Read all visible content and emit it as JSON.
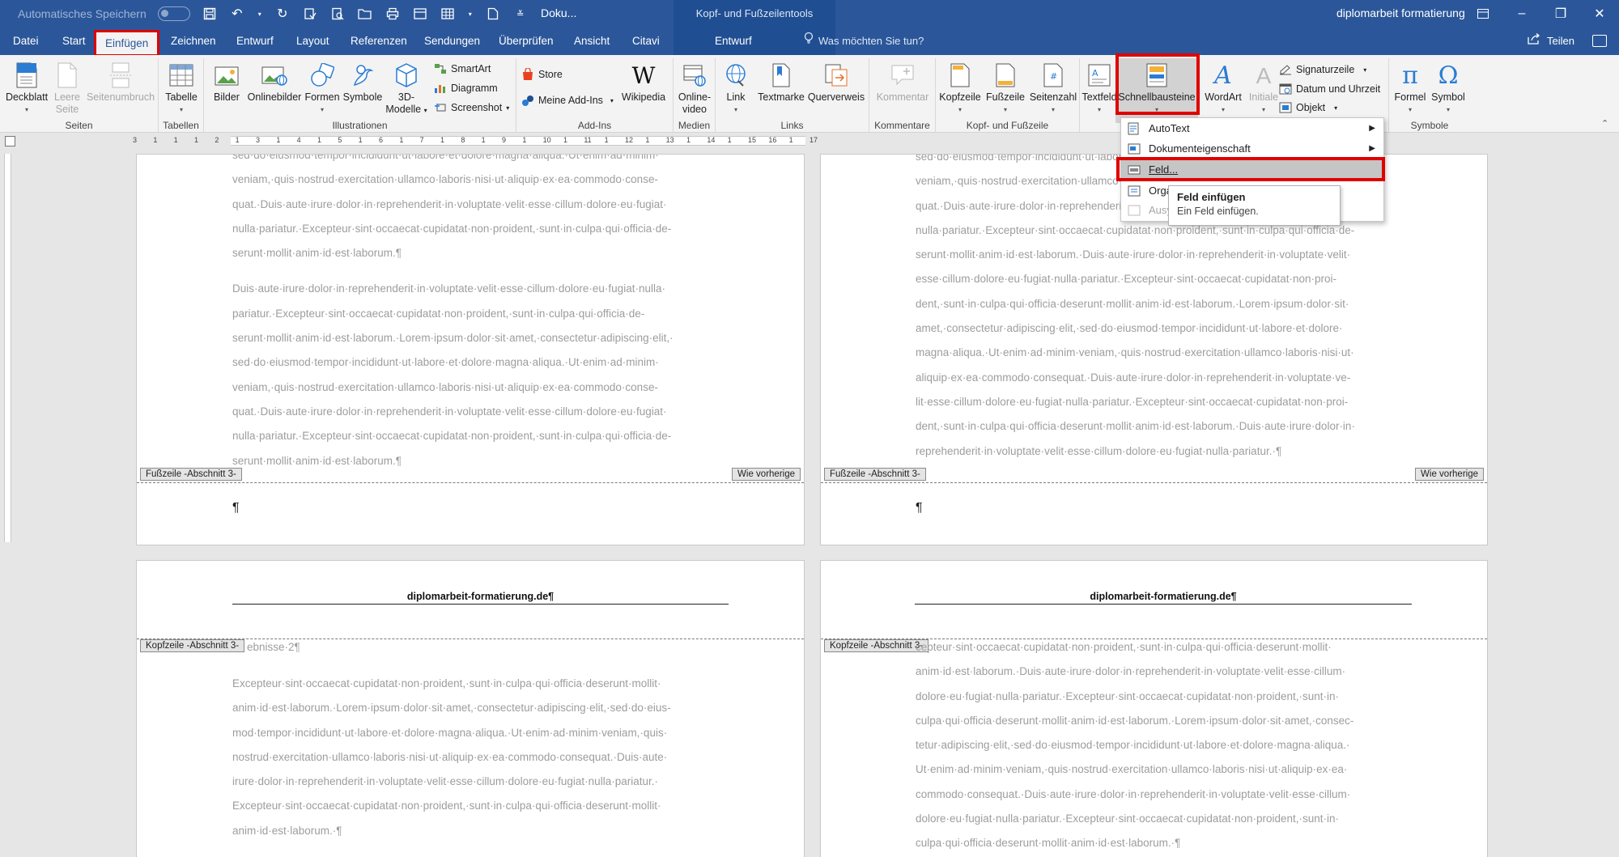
{
  "titlebar": {
    "autosave_label": "Automatisches Speichern",
    "doc_title": "Doku...",
    "context_title": "Kopf- und Fußzeilentools",
    "user": "diplomarbeit formatierung"
  },
  "tabs": [
    {
      "label": "Datei"
    },
    {
      "label": "Start"
    },
    {
      "label": "Einfügen"
    },
    {
      "label": "Zeichnen"
    },
    {
      "label": "Entwurf"
    },
    {
      "label": "Layout"
    },
    {
      "label": "Referenzen"
    },
    {
      "label": "Sendungen"
    },
    {
      "label": "Überprüfen"
    },
    {
      "label": "Ansicht"
    },
    {
      "label": "Citavi"
    },
    {
      "label": "Entwurf"
    }
  ],
  "search_placeholder": "Was möchten Sie tun?",
  "share_label": "Teilen",
  "ribbon": {
    "groups": {
      "seiten": "Seiten",
      "tabellen": "Tabellen",
      "illustrationen": "Illustrationen",
      "addins": "Add-Ins",
      "medien": "Medien",
      "links": "Links",
      "kommentare": "Kommentare",
      "kopffuss": "Kopf- und Fußzeile",
      "symbole": "Symbole"
    },
    "buttons": {
      "deckblatt": "Deckblatt",
      "leere_seite_1": "Leere",
      "leere_seite_2": "Seite",
      "seitenumbruch": "Seitenumbruch",
      "tabelle": "Tabelle",
      "bilder": "Bilder",
      "onlinebilder": "Onlinebilder",
      "formen": "Formen",
      "symbole_btn": "Symbole",
      "modelle_1": "3D-",
      "modelle_2": "Modelle",
      "smartart": "SmartArt",
      "diagramm": "Diagramm",
      "screenshot": "Screenshot",
      "store": "Store",
      "meine_addins": "Meine Add-Ins",
      "wikipedia": "Wikipedia",
      "onlinevideo_1": "Online-",
      "onlinevideo_2": "video",
      "link": "Link",
      "textmarke": "Textmarke",
      "querverweis": "Querverweis",
      "kommentar": "Kommentar",
      "kopfzeile": "Kopfzeile",
      "fusszeile": "Fußzeile",
      "seitenzahl": "Seitenzahl",
      "textfeld": "Textfeld",
      "schnellbausteine": "Schnellbausteine",
      "wordart": "WordArt",
      "initiale": "Initiale",
      "signaturzeile": "Signaturzeile",
      "datum": "Datum und Uhrzeit",
      "objekt": "Objekt",
      "formel": "Formel",
      "symbol": "Symbol"
    }
  },
  "ruler_ticks": [
    "3",
    "1",
    "1",
    "1",
    "2",
    "1",
    "3",
    "1",
    "4",
    "1",
    "5",
    "1",
    "6",
    "1",
    "7",
    "1",
    "8",
    "1",
    "9",
    "1",
    "10",
    "1",
    "11",
    "1",
    "12",
    "1",
    "13",
    "1",
    "14",
    "1",
    "15",
    "16",
    "1",
    "17"
  ],
  "dropdown": {
    "items": [
      "AutoText",
      "Dokumenteigenschaft",
      "Feld...",
      "Orga",
      "Ausy"
    ],
    "tooltip_title": "Feld einfügen",
    "tooltip_desc": "Ein Feld einfügen."
  },
  "pages": {
    "p1_paragraphs": [
      "sed·do·eiusmod·tempor·incididunt·ut·labore·et·dolore·magna·aliqua.·Ut·enim·ad·minim· veniam,·quis·nostrud·exercitation·ullamco·laboris·nisi·ut·aliquip·ex·ea·commodo·conse- quat.·Duis·aute·irure·dolor·in·reprehenderit·in·voluptate·velit·esse·cillum·dolore·eu·fugiat· nulla·pariatur.·Excepteur·sint·occaecat·cupidatat·non·proident,·sunt·in·culpa·qui·officia·de- serunt·mollit·anim·id·est·laborum.¶",
      "Duis·aute·irure·dolor·in·reprehenderit·in·voluptate·velit·esse·cillum·dolore·eu·fugiat·nulla· pariatur.·Excepteur·sint·occaecat·cupidatat·non·proident,·sunt·in·culpa·qui·officia·de- serunt·mollit·anim·id·est·laborum.·Lorem·ipsum·dolor·sit·amet,·consectetur·adipiscing·elit,· sed·do·eiusmod·tempor·incididunt·ut·labore·et·dolore·magna·aliqua.·Ut·enim·ad·minim· veniam,·quis·nostrud·exercitation·ullamco·laboris·nisi·ut·aliquip·ex·ea·commodo·conse- quat.·Duis·aute·irure·dolor·in·reprehenderit·in·voluptate·velit·esse·cillum·dolore·eu·fugiat· nulla·pariatur.·Excepteur·sint·occaecat·cupidatat·non·proident,·sunt·in·culpa·qui·officia·de- serunt·mollit·anim·id·est·laborum.¶"
    ],
    "p2_paragraph": "sed·do·eiusmod·tempor·incididunt·ut·labore·et·dolore·magna·aliqua.·Ut·enim·ad·minim· veniam,·quis·nostrud·exercitation·ullamco·laboris·nisi·ut·aliquip·ex·ea·commodo·conse- quat.·Duis·aute·irure·dolor·in·reprehenderit·in·voluptate·velit·esse·cillum·dolore·eu·fugiat· nulla·pariatur.·Excepteur·sint·occaecat·cupidatat·non·proident,·sunt·in·culpa·qui·officia·de- serunt·mollit·anim·id·est·laborum.·Duis·aute·irure·dolor·in·reprehenderit·in·voluptate·velit· esse·cillum·dolore·eu·fugiat·nulla·pariatur.·Excepteur·sint·occaecat·cupidatat·non·proi- dent,·sunt·in·culpa·qui·officia·deserunt·mollit·anim·id·est·laborum.·Lorem·ipsum·dolor·sit· amet,·consectetur·adipiscing·elit,·sed·do·eiusmod·tempor·incididunt·ut·labore·et·dolore· magna·aliqua.·Ut·enim·ad·minim·veniam,·quis·nostrud·exercitation·ullamco·laboris·nisi·ut· aliquip·ex·ea·commodo·consequat.·Duis·aute·irure·dolor·in·reprehenderit·in·voluptate·ve- lit·esse·cillum·dolore·eu·fugiat·nulla·pariatur.·Excepteur·sint·occaecat·cupidatat·non·proi- dent,·sunt·in·culpa·qui·officia·deserunt·mollit·anim·id·est·laborum.·Duis·aute·irure·dolor·in· reprehenderit·in·voluptate·velit·esse·cillum·dolore·eu·fugiat·nulla·pariatur.·¶",
    "footer_label": "Fußzeile -Abschnitt 3-",
    "same_as_prev": "Wie vorherige",
    "header_label": "Kopfzeile -Abschnitt 3-",
    "header_text": "diplomarbeit-formatierung.de¶",
    "pilcrow": "¶",
    "p3_heading_tail": "ebnisse·2¶",
    "p3_paragraph": "Excepteur·sint·occaecat·cupidatat·non·proident,·sunt·in·culpa·qui·officia·deserunt·mollit· anim·id·est·laborum.·Lorem·ipsum·dolor·sit·amet,·consectetur·adipiscing·elit,·sed·do·eius- mod·tempor·incididunt·ut·labore·et·dolore·magna·aliqua.·Ut·enim·ad·minim·veniam,·quis· nostrud·exercitation·ullamco·laboris·nisi·ut·aliquip·ex·ea·commodo·consequat.·Duis·aute· irure·dolor·in·reprehenderit·in·voluptate·velit·esse·cillum·dolore·eu·fugiat·nulla·pariatur.· Excepteur·sint·occaecat·cupidatat·non·proident,·sunt·in·culpa·qui·officia·deserunt·mollit· anim·id·est·laborum.·¶",
    "p4_paragraph": "cepteur·sint·occaecat·cupidatat·non·proident,·sunt·in·culpa·qui·officia·deserunt·mollit· anim·id·est·laborum.·Duis·aute·irure·dolor·in·reprehenderit·in·voluptate·velit·esse·cillum· dolore·eu·fugiat·nulla·pariatur.·Excepteur·sint·occaecat·cupidatat·non·proident,·sunt·in· culpa·qui·officia·deserunt·mollit·anim·id·est·laborum.·Lorem·ipsum·dolor·sit·amet,·consec- tetur·adipiscing·elit,·sed·do·eiusmod·tempor·incididunt·ut·labore·et·dolore·magna·aliqua.· Ut·enim·ad·minim·veniam,·quis·nostrud·exercitation·ullamco·laboris·nisi·ut·aliquip·ex·ea· commodo·consequat.·Duis·aute·irure·dolor·in·reprehenderit·in·voluptate·velit·esse·cillum· dolore·eu·fugiat·nulla·pariatur.·Excepteur·sint·occaecat·cupidatat·non·proident,·sunt·in· culpa·qui·officia·deserunt·mollit·anim·id·est·laborum.·¶"
  },
  "colors": {
    "word_blue": "#2b579a",
    "highlight_red": "#e00000"
  }
}
